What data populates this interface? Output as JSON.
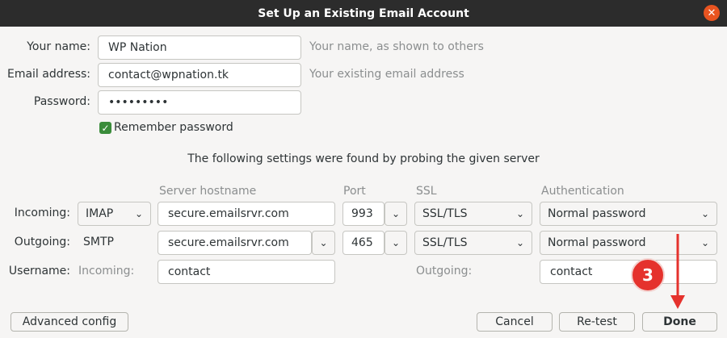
{
  "window": {
    "title": "Set Up an Existing Email Account"
  },
  "identity": {
    "name_label": "Your name:",
    "name_value": "WP Nation",
    "name_hint": "Your name, as shown to others",
    "email_label": "Email address:",
    "email_value": "contact@wpnation.tk",
    "email_hint": "Your existing email address",
    "password_label": "Password:",
    "password_value": "•••••••••",
    "remember_label": "Remember password"
  },
  "probe_message": "The following settings were found by probing the given server",
  "columns": {
    "hostname": "Server hostname",
    "port": "Port",
    "ssl": "SSL",
    "auth": "Authentication"
  },
  "incoming": {
    "label": "Incoming:",
    "protocol": "IMAP",
    "hostname": "secure.emailsrvr.com",
    "port": "993",
    "ssl": "SSL/TLS",
    "auth": "Normal password"
  },
  "outgoing": {
    "label": "Outgoing:",
    "protocol": "SMTP",
    "hostname": "secure.emailsrvr.com",
    "port": "465",
    "ssl": "SSL/TLS",
    "auth": "Normal password"
  },
  "username": {
    "label": "Username:",
    "incoming_label": "Incoming:",
    "incoming_value": "contact",
    "outgoing_label": "Outgoing:",
    "outgoing_value": "contact"
  },
  "buttons": {
    "advanced": "Advanced config",
    "cancel": "Cancel",
    "retest": "Re-test",
    "done": "Done"
  },
  "annotation": {
    "step": "3",
    "color": "#e5322d"
  },
  "colors": {
    "titlebar": "#2c2c2c",
    "close": "#e95420",
    "check": "#3a8c3a"
  }
}
